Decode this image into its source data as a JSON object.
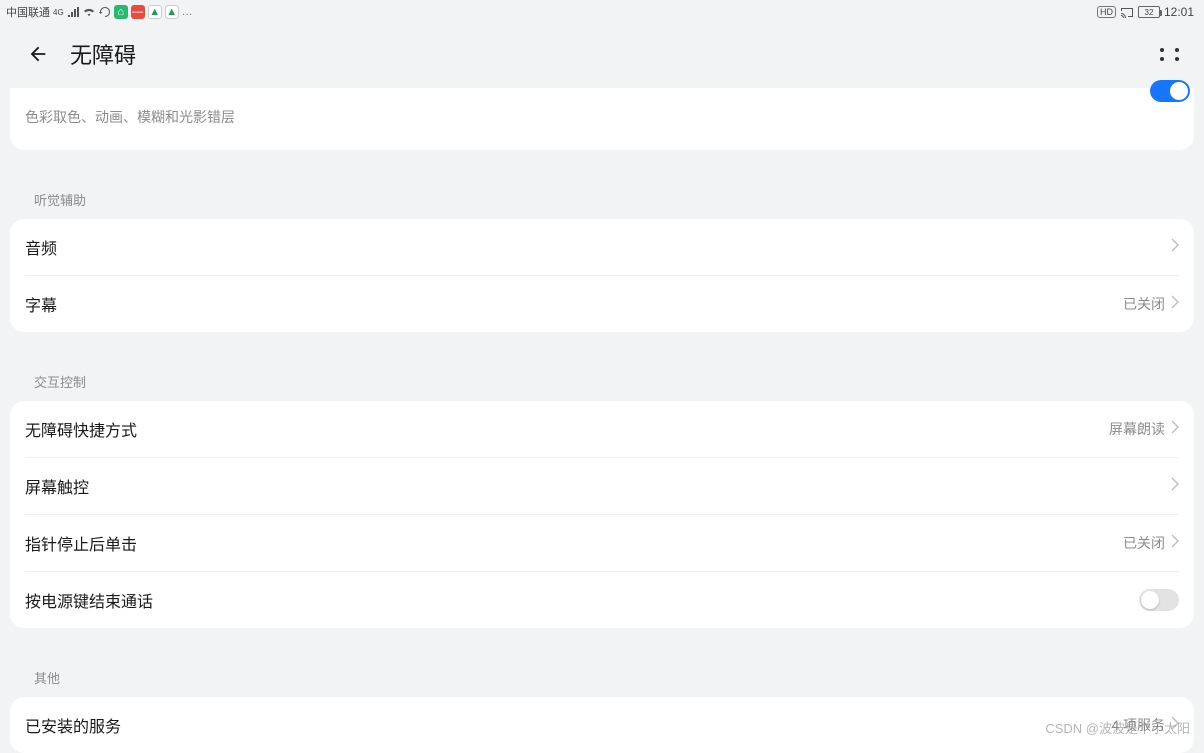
{
  "statusBar": {
    "carrier": "中国联通",
    "network": "4G",
    "battery": "32",
    "time": "12:01",
    "hd": "HD"
  },
  "header": {
    "title": "无障碍"
  },
  "topRow": {
    "label": "色彩取色、动画、模糊和光影错层"
  },
  "sections": {
    "hearing": {
      "title": "听觉辅助",
      "audio": "音频",
      "subtitle": "字幕",
      "subtitleValue": "已关闭"
    },
    "interaction": {
      "title": "交互控制",
      "shortcut": "无障碍快捷方式",
      "shortcutValue": "屏幕朗读",
      "touch": "屏幕触控",
      "dwell": "指针停止后单击",
      "dwellValue": "已关闭",
      "powerEnd": "按电源键结束通话"
    },
    "other": {
      "title": "其他",
      "installed": "已安装的服务",
      "installedValue": "4 项服务"
    }
  },
  "watermark": "CSDN @波波是个小太阳"
}
